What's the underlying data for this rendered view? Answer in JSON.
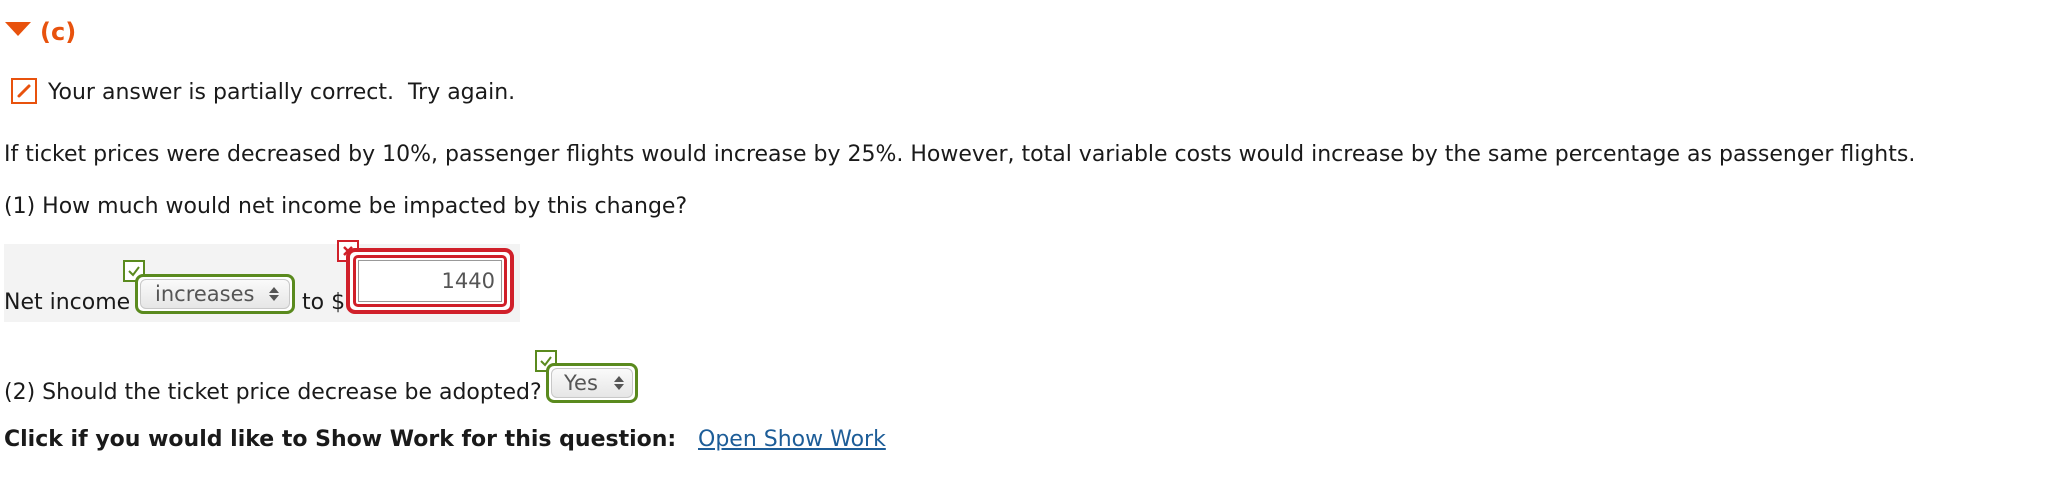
{
  "section": {
    "label": "(c)"
  },
  "feedback": {
    "text": "Your answer is partially correct.  Try again."
  },
  "problem": {
    "statement": "If ticket prices were decreased by 10%, passenger flights would increase by 25%. However, total variable costs would increase by the same percentage as passenger flights.",
    "q1": "(1) How much would net income be impacted by this change?",
    "q2": "(2) Should the ticket price decrease be adopted?"
  },
  "answer_row": {
    "net_income_label": "Net income",
    "direction_value": "increases",
    "direction_status": "correct",
    "to_label": "to $",
    "amount_value": "1440",
    "amount_status": "incorrect"
  },
  "adopt": {
    "value": "Yes",
    "status": "correct"
  },
  "show_work": {
    "prompt": "Click if you would like to Show Work for this question:",
    "link": "Open Show Work"
  },
  "colors": {
    "accent": "#e8520d",
    "correct": "#5a8a1e",
    "incorrect": "#d0202a",
    "link": "#1d5d98"
  }
}
